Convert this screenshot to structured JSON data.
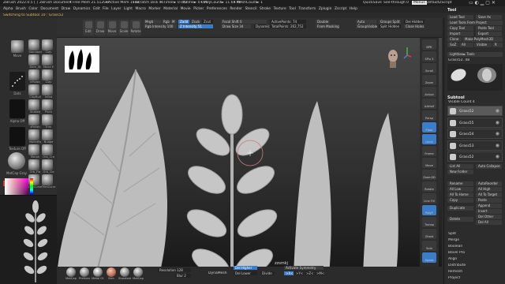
{
  "titlebar": {
    "app": "ZBrush 2022.0.5 [ ]",
    "document": "ZBrush Document",
    "free_mem": "• Free Mem 21.512GB",
    "active_mem": "• Active Mem 1589",
    "scratch_disk": "• Scratch Disk 45",
    "timer": "• Timer► 0.002",
    "atime": "ATime► 0.016",
    "poly_count": "• PolyCount► 11.64 KP",
    "mesh_count": "• MeshCount► 1",
    "quicksave": "QuickSave",
    "see_through": "See-through 0",
    "menus_btn": "Menus",
    "default_zscript": "DefaultZScript"
  },
  "menubar": [
    "Alpha",
    "Brush",
    "Color",
    "Document",
    "Draw",
    "Dynamics",
    "Edit",
    "File",
    "Layer",
    "Light",
    "Macro",
    "Marker",
    "Material",
    "Movie",
    "Picker",
    "Preferences",
    "Render",
    "Stencil",
    "Stroke",
    "Texture",
    "Tool",
    "Transform",
    "Zplugin",
    "Zscript",
    "Help"
  ],
  "notice": "Switching to Subtool 10 : Grass52",
  "shelf": {
    "projection_master": "Projection Master",
    "lightbox": "LightBox",
    "buttons": [
      "Edit",
      "Draw",
      "Move",
      "Scale",
      "Rotate"
    ],
    "mrgb": "Mrgb",
    "rgb": "Rgb",
    "m": "M",
    "zadd": "Zadd",
    "zsub": "Zsub",
    "zcut": "Zcut",
    "rgb_intensity": "Rgb Intensity 100",
    "z_intensity": "Z Intensity 51",
    "focal_shift": "Focal Shift 0",
    "draw_size": "Draw Size 34",
    "dynamic": "Dynamic",
    "active_points": "ActivePoints: 74",
    "total_points": "TotalPoints: 262,752",
    "double": "Double",
    "from_masking": "From Masking",
    "auto_groups": "Auto Groups",
    "group_visible": "GroupVisible",
    "groups_split": "Groups Split",
    "split_hidden": "Split Hidden",
    "del_hidden": "Del Hidden",
    "close_holes": "Close Holes"
  },
  "lefttray": {
    "brushes": [
      {
        "name": "Move"
      },
      {
        "name": "Standard"
      },
      {
        "name": "Clay"
      },
      {
        "name": "Dam_St"
      },
      {
        "name": "Move E"
      },
      {
        "name": "hPolish"
      },
      {
        "name": "Clay"
      },
      {
        "name": "ClayBuil"
      },
      {
        "name": "Inflat"
      },
      {
        "name": "Snakeh"
      },
      {
        "name": "Pinch"
      },
      {
        "name": "sPolish"
      },
      {
        "name": "Trim"
      },
      {
        "name": "MalletFa"
      },
      {
        "name": "Nudge"
      },
      {
        "name": "Morph"
      },
      {
        "name": "Orb_Cra"
      },
      {
        "name": "Orb_Fla"
      },
      {
        "name": "Orb_Cla"
      },
      {
        "name": "ClipCurve"
      },
      {
        "name": "TrimCurve"
      }
    ],
    "dots": "Dots",
    "alpha_off": "Alpha Off",
    "texture_off": "Texture Off",
    "matcap_gray": "MatCap Gray",
    "fill_object": "FillObject",
    "gradient": "Gradient",
    "switch_color": "SwitchColor"
  },
  "canvas": {
    "label": "zzsmkj",
    "current_subtool": "Grass52"
  },
  "rightpanel": {
    "tool_title": "Tool",
    "load_tool": "Load Tool",
    "save_as": "Save As",
    "load_tools_from_project": "Load Tools From Project",
    "copy_tool": "Copy Tool",
    "paste_tool": "Paste Tool",
    "import": "Import",
    "export": "Export",
    "clone": "Clone",
    "make_polymesh3d": "Make PolyMesh3D",
    "goz": "GoZ",
    "all": "All",
    "visible": "Visible",
    "r": "R",
    "lightbox_tools": "Lightbox► Tools",
    "current_tool": "Grass52. 48",
    "subtool_title": "Subtool",
    "visible_count": "Visible Count 4",
    "subtools": [
      "Grass52",
      "Grass55",
      "Grass54",
      "Grass53",
      "Grass52"
    ],
    "list_all": "List All",
    "auto_collapse": "Auto Collapse",
    "new_folder": "New Folder",
    "rename": "Rename",
    "auto_reorder": "AutoReorder",
    "all_low": "All Low",
    "all_high": "All High",
    "all_to_home": "All To Home",
    "all_to_target": "All To Target",
    "copy": "Copy",
    "paste": "Paste",
    "duplicate": "Duplicate",
    "append": "Append",
    "insert": "Insert",
    "delete": "Delete",
    "del_other": "Del Other",
    "del_all": "Del All",
    "split": "Split",
    "merge": "Merge",
    "boolean": "Boolean",
    "bevel_pro": "Bevel Pro",
    "align": "Align",
    "distribute": "Distribute",
    "remesh": "Remesh",
    "project": "Project"
  },
  "rightshelf": [
    "BPR",
    "SPix 3",
    "Scroll",
    "Zoom",
    "Actual",
    "AAHalf",
    "Persp",
    "Floor",
    "Local",
    "Frame",
    "Move",
    "Zoom3D",
    "Rotate",
    "Line Fill",
    "PolyF",
    "Transp",
    "Ghost",
    "Solo",
    "Xpose"
  ],
  "bottombar": {
    "resolution": "Resolution 128",
    "blur": "Blur 2",
    "dynamesh": "DynaMesh",
    "del_higher": "Del Higher",
    "del_lower": "Del Lower",
    "divide": "Divide",
    "activate_symmetry": "Activate Symmetry",
    "x": ">X<",
    "y": ">Y<",
    "z": ">Z<",
    "m": ">M<",
    "materials": [
      "MatCap",
      "Prefrom",
      "Metal 01",
      "Skin",
      "Standard",
      "MatCap"
    ]
  },
  "colors": {
    "accent": "#3a7dc9",
    "panel": "#2c2c2c",
    "viewport_top": "#474747",
    "viewport_bottom": "#1a1a1a"
  }
}
